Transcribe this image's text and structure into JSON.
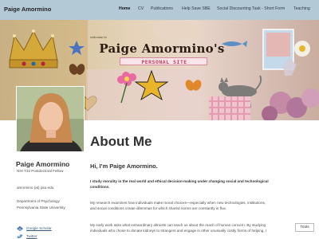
{
  "site": {
    "title": "Paige Amormino",
    "colors": {
      "masthead": "#b3c9d6",
      "link": "#3b5b7a",
      "heading": "#313131"
    }
  },
  "nav": {
    "items": [
      {
        "label": "Home",
        "active": true
      },
      {
        "label": "CV"
      },
      {
        "label": "Publications"
      },
      {
        "label": "Help Save SBE"
      },
      {
        "label": "Social Discounting Task - Short Form"
      },
      {
        "label": "Teaching"
      }
    ]
  },
  "banner": {
    "welcome": "welcome to",
    "title": "Paige Amormino's",
    "subtitle": "PERSONAL SITE"
  },
  "author": {
    "name": "Paige Amormino",
    "position": "NIH T32 Postdoctoral Fellow",
    "email": "amormino (at) psu.edu",
    "department": "Department of Psychology",
    "university": "Pennsylvania State University",
    "links": [
      {
        "label": "Google Scholar",
        "icon": "google-scholar-icon"
      },
      {
        "label": "Twitter",
        "icon": "twitter-icon"
      }
    ]
  },
  "main": {
    "title": "About Me",
    "greeting": "Hi, I’m Paige Amormino.",
    "intro": [
      "I study morality in the real world and ethical decision-making under changing social and technological",
      "conditions."
    ],
    "research": [
      "My research examines how individuals make moral choices—especially when new technologies, institutions,",
      "and social conditions create dilemmas for which shared norms are constantly in flux."
    ],
    "early_work": [
      "My early work asks what extraordinary altruists can teach us about the reach of human concern. By studying",
      "individuals who chose to donate kidneys to strangers and engage in other unusually costly forms of helping, I"
    ]
  },
  "tools": {
    "label": "Tools"
  }
}
